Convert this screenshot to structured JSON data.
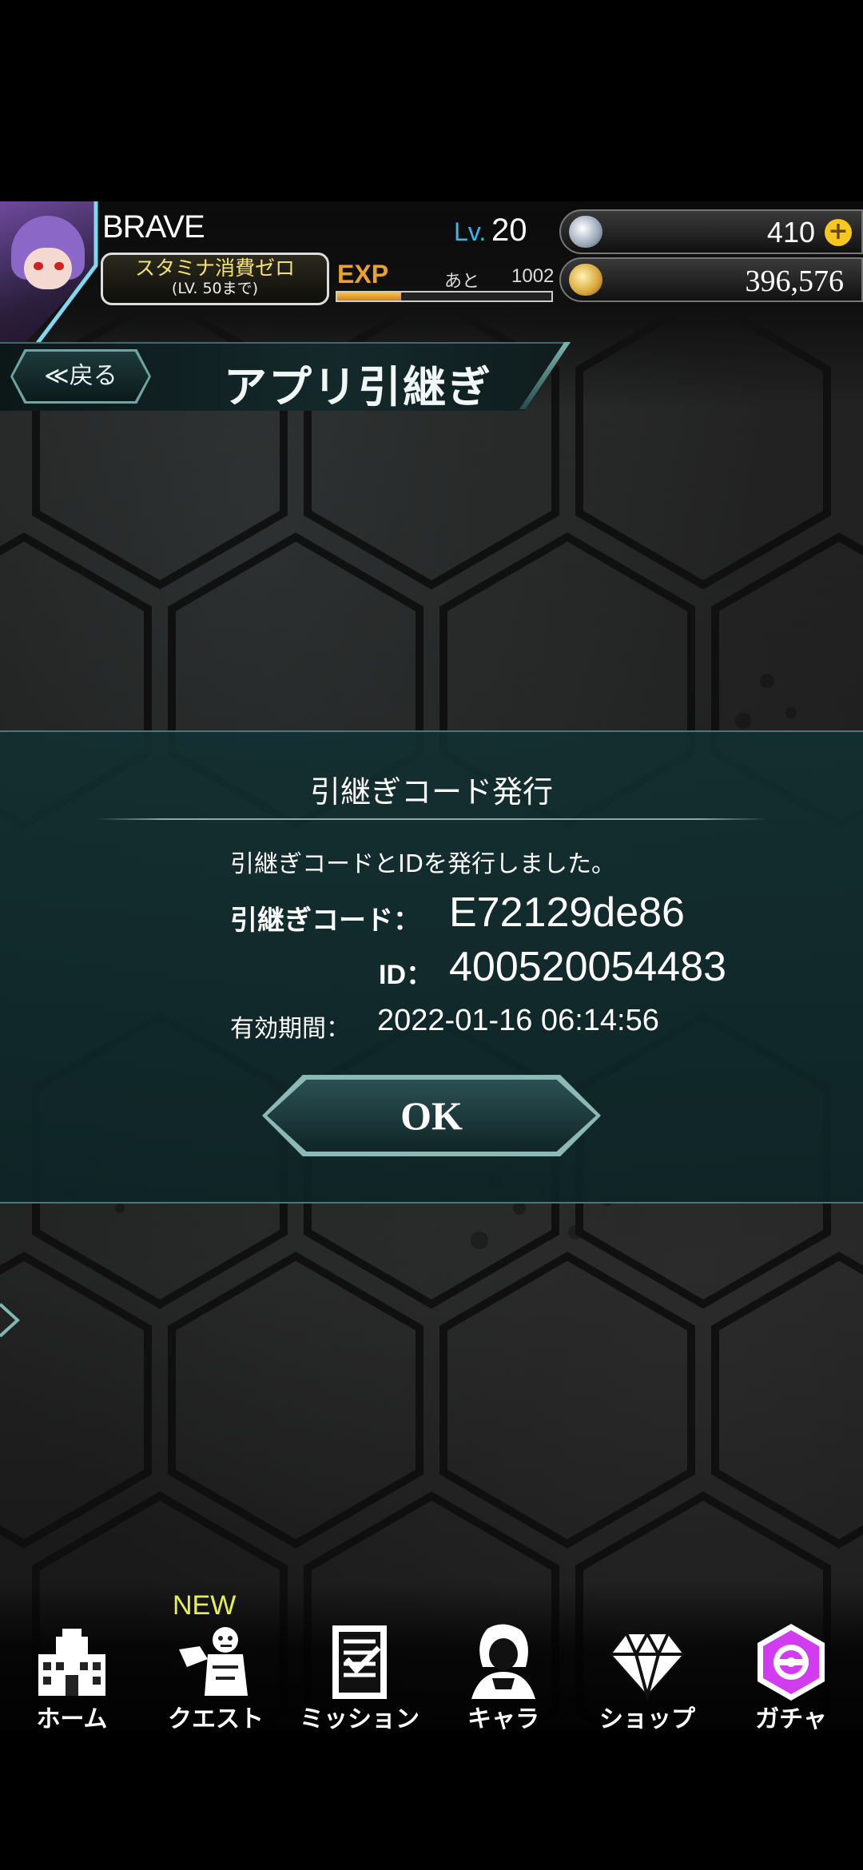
{
  "player": {
    "name": "BRAVE",
    "level_label": "Lv.",
    "level": "20",
    "stamina_badge_line1": "スタミナ消費ゼロ",
    "stamina_badge_line2": "(LV. 50まで)",
    "exp_label": "EXP",
    "exp_remaining_label": "あと",
    "exp_remaining_value": "1002",
    "exp_progress": 0.3
  },
  "currency": {
    "gems": "410",
    "add_gems_symbol": "+",
    "coins": "396,576"
  },
  "header": {
    "back_label": "≪戻る",
    "title": "アプリ引継ぎ"
  },
  "dialog": {
    "title": "引継ぎコード発行",
    "message": "引継ぎコードとIDを発行しました。",
    "code_label": "引継ぎコード：",
    "code_value": "E72129de86",
    "id_label": "ID：",
    "id_value": "400520054483",
    "expiry_label": "有効期間：",
    "expiry_value": "2022-01-16 06:14:56",
    "ok_label": "OK"
  },
  "nav": {
    "new_badge": "NEW",
    "items": [
      {
        "label": "ホーム",
        "icon": "home-building-icon"
      },
      {
        "label": "クエスト",
        "icon": "quest-zombie-icon"
      },
      {
        "label": "ミッション",
        "icon": "mission-checklist-icon"
      },
      {
        "label": "キャラ",
        "icon": "character-icon"
      },
      {
        "label": "ショップ",
        "icon": "diamond-shop-icon"
      },
      {
        "label": "ガチャ",
        "icon": "gacha-icon"
      }
    ]
  },
  "colors": {
    "level_accent": "#39b8e8",
    "exp_accent": "#e9a32c",
    "dialog_background": "#12302f",
    "new_badge": "#e8f04a",
    "gacha_accent": "#d23cf0"
  }
}
